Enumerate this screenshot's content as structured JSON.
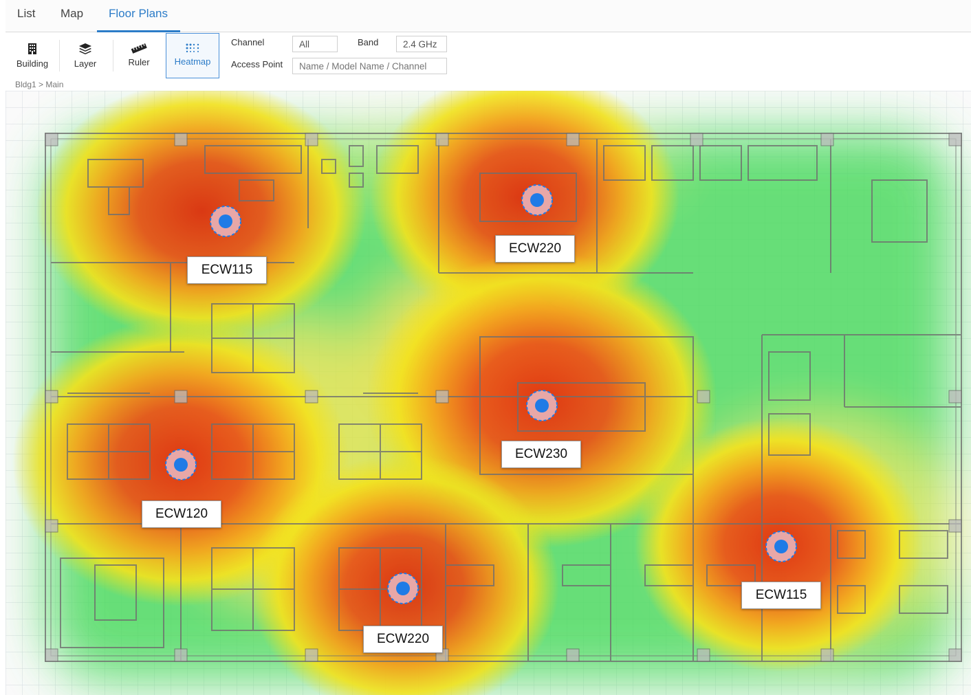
{
  "tabs": [
    {
      "label": "List",
      "active": false
    },
    {
      "label": "Map",
      "active": false
    },
    {
      "label": "Floor Plans",
      "active": true
    }
  ],
  "toolbar": {
    "tools": [
      {
        "label": "Building",
        "icon": "building-icon"
      },
      {
        "label": "Layer",
        "icon": "layers-icon"
      },
      {
        "label": "Ruler",
        "icon": "ruler-icon"
      },
      {
        "label": "Heatmap",
        "icon": "heatmap-icon",
        "active": true
      }
    ]
  },
  "filters": {
    "channel_label": "Channel",
    "channel_value": "All",
    "band_label": "Band",
    "band_value": "2.4 GHz",
    "access_point_label": "Access Point",
    "access_point_placeholder": "Name / Model Name / Channel"
  },
  "breadcrumb": "Bldg1 > Main",
  "access_points": [
    {
      "name": "ECW115"
    },
    {
      "name": "ECW220"
    },
    {
      "name": "ECW120"
    },
    {
      "name": "ECW230"
    },
    {
      "name": "ECW220"
    },
    {
      "name": "ECW115"
    }
  ],
  "colors": {
    "accent": "#2c7cc8",
    "ap_dot": "#1f7be6",
    "ap_ring": "#e8a7a7",
    "heat_strong": "#e53a12",
    "heat_medium": "#f5e11a",
    "heat_weak": "#3ddc5a"
  }
}
